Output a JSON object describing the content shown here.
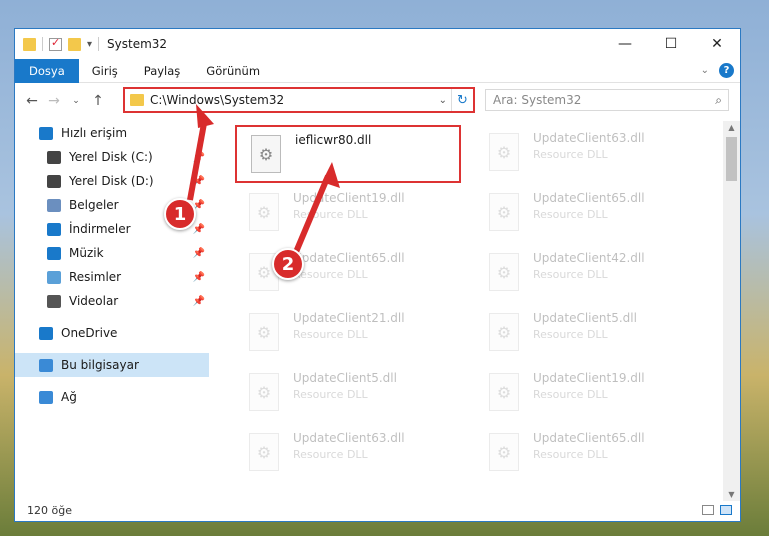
{
  "window": {
    "title": "System32"
  },
  "ribbon": {
    "tabs": [
      "Dosya",
      "Giriş",
      "Paylaş",
      "Görünüm"
    ]
  },
  "address": {
    "path": "C:\\Windows\\System32"
  },
  "search": {
    "placeholder": "Ara: System32"
  },
  "sidebar": {
    "items": [
      {
        "label": "Hızlı erişim",
        "icon": "star-icon",
        "color": "#1979ca"
      },
      {
        "label": "Yerel Disk (C:)",
        "icon": "drive-icon",
        "color": "#444444"
      },
      {
        "label": "Yerel Disk (D:)",
        "icon": "drive-icon",
        "color": "#444444"
      },
      {
        "label": "Belgeler",
        "icon": "documents-icon",
        "color": "#6b8fbf"
      },
      {
        "label": "İndirmeler",
        "icon": "download-icon",
        "color": "#1979ca"
      },
      {
        "label": "Müzik",
        "icon": "music-icon",
        "color": "#1979ca"
      },
      {
        "label": "Resimler",
        "icon": "pictures-icon",
        "color": "#5aa0d8"
      },
      {
        "label": "Videolar",
        "icon": "videos-icon",
        "color": "#555555"
      },
      {
        "label": "OneDrive",
        "icon": "cloud-icon",
        "color": "#1979ca"
      },
      {
        "label": "Bu bilgisayar",
        "icon": "computer-icon",
        "color": "#3a8ad6"
      },
      {
        "label": "Ağ",
        "icon": "network-icon",
        "color": "#3a8ad6"
      }
    ]
  },
  "files": [
    {
      "name": "ieflicwr80.dll",
      "type": ""
    },
    {
      "name": "UpdateClient63.dll",
      "type": "Resource DLL"
    },
    {
      "name": "UpdateClient19.dll",
      "type": "Resource DLL"
    },
    {
      "name": "UpdateClient65.dll",
      "type": "Resource DLL"
    },
    {
      "name": "UpdateClient65.dll",
      "type": "Resource DLL"
    },
    {
      "name": "UpdateClient42.dll",
      "type": "Resource DLL"
    },
    {
      "name": "UpdateClient21.dll",
      "type": "Resource DLL"
    },
    {
      "name": "UpdateClient5.dll",
      "type": "Resource DLL"
    },
    {
      "name": "UpdateClient5.dll",
      "type": "Resource DLL"
    },
    {
      "name": "UpdateClient19.dll",
      "type": "Resource DLL"
    },
    {
      "name": "UpdateClient63.dll",
      "type": "Resource DLL"
    },
    {
      "name": "UpdateClient65.dll",
      "type": "Resource DLL"
    }
  ],
  "status": {
    "count": "120 öğe"
  },
  "callouts": [
    "1",
    "2"
  ],
  "colors": {
    "accent": "#1979ca",
    "highlight": "#d33333"
  }
}
